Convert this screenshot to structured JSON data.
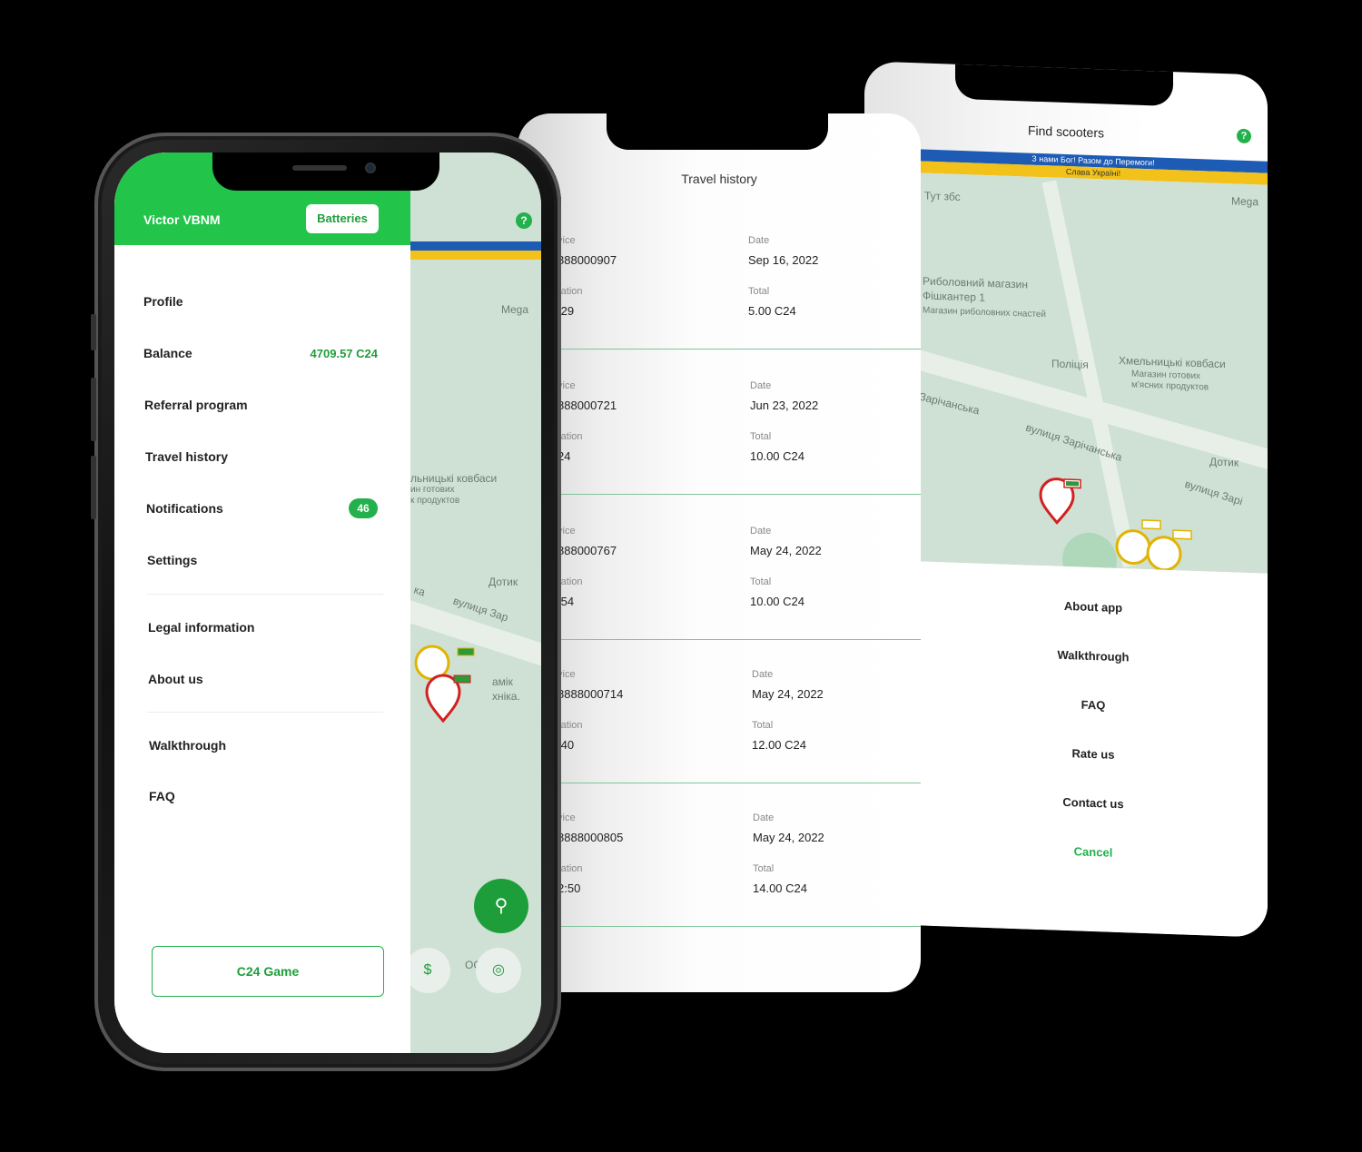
{
  "find_scooters": {
    "title": "Find scooters",
    "help": "?",
    "banner_blue": "З нами Бог! Разом до Перемоги!",
    "banner_yellow": "Слава Україні!",
    "map_labels": [
      "Тут збс",
      "Mega",
      "Риболовний магазин",
      "Фішкантер 1",
      "Магазин риболовних снастей",
      "Поліція",
      "Хмельницькі ковбаси",
      "Магазин готових",
      "м'ясних продуктов",
      "Зарічанська",
      "вулиця Зарічанська",
      "Дотик",
      "вулиця Зарі"
    ],
    "sheet_items": [
      "About app",
      "Walkthrough",
      "FAQ",
      "Rate us",
      "Contact us",
      "Cancel"
    ]
  },
  "travel_history": {
    "title": "Travel history",
    "device_label": "vice",
    "duration_label": "ration",
    "date_label": "Date",
    "total_label": "Total",
    "trips": [
      {
        "device": "888000907",
        "duration": ":29",
        "date": "Sep 16, 2022",
        "total": "5.00 C24"
      },
      {
        "device": "888000721",
        "duration": "24",
        "date": "Jun 23, 2022",
        "total": "10.00 C24"
      },
      {
        "device": "888000767",
        "duration": ":54",
        "date": "May 24, 2022",
        "total": "10.00 C24"
      },
      {
        "device": "8888000714",
        "duration": ":40",
        "date": "May 24, 2022",
        "total": "12.00 C24"
      },
      {
        "device": "8888000805",
        "duration": "2:50",
        "date": "May 24, 2022",
        "total": "14.00 C24"
      }
    ]
  },
  "drawer": {
    "user_name": "Victor VBNM",
    "batteries_label": "Batteries",
    "menu": {
      "profile": "Profile",
      "balance": "Balance",
      "balance_value": "4709.57 C24",
      "referral": "Referral program",
      "travel_history": "Travel history",
      "notifications": "Notifications",
      "notifications_count": "46",
      "settings": "Settings",
      "legal": "Legal information",
      "about": "About us",
      "walkthrough": "Walkthrough",
      "faq": "FAQ"
    },
    "game_button": "C24 Game"
  },
  "front_map": {
    "help": "?",
    "labels": [
      "Mega",
      "льницькі ковбаси",
      "ин готових",
      "к продуктов",
      "Дотик",
      "ка",
      "вулиця Зар",
      "амік",
      "хніка.",
      "OG"
    ]
  },
  "colors": {
    "brand_green": "#22c44a",
    "accent_green": "#1e9e3a",
    "flag_blue": "#1d5bb5",
    "flag_yellow": "#f2c21a",
    "map_bg": "#cfe1d4"
  }
}
